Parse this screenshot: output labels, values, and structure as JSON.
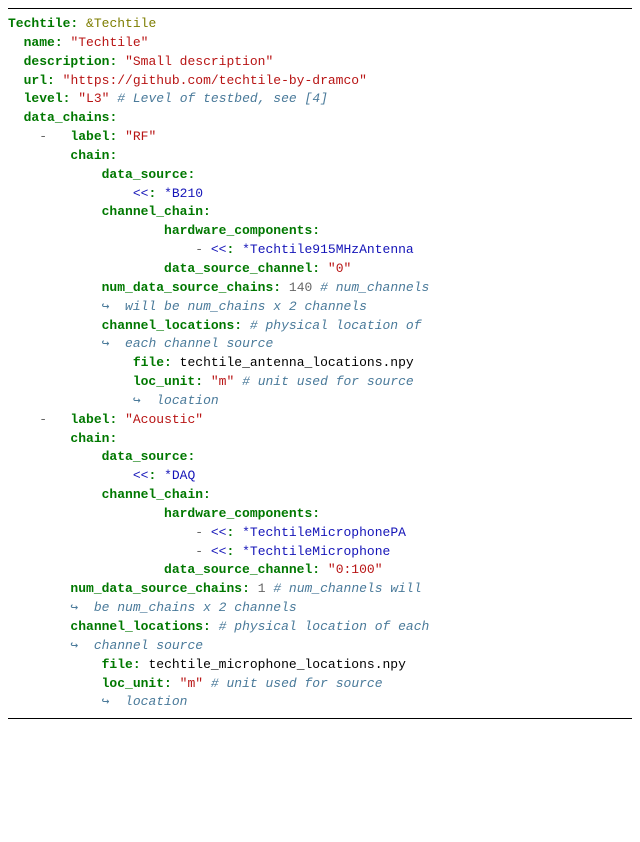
{
  "root": {
    "key": "Techtile",
    "anchor": "&Techtile"
  },
  "name": {
    "key": "name",
    "val": "\"Techtile\""
  },
  "description": {
    "key": "description",
    "val": "\"Small description\""
  },
  "url": {
    "key": "url",
    "val": "\"https://github.com/techtile-by-dramco\""
  },
  "level": {
    "key": "level",
    "val": "\"L3\"",
    "comment": "# Level of testbed, see [4]"
  },
  "data_chains_key": "data_chains",
  "item1": {
    "label": {
      "key": "label",
      "val": "\"RF\""
    },
    "chain_key": "chain",
    "data_source_key": "data_source",
    "merge": "<<",
    "b210": "*B210",
    "channel_chain_key": "channel_chain",
    "hardware_components_key": "hardware_components",
    "antenna": "*Techtile915MHzAntenna",
    "data_source_channel": {
      "key": "data_source_channel",
      "val": "\"0\""
    },
    "num_chains": {
      "key": "num_data_source_chains",
      "val": "140",
      "comment": "# num_channels"
    },
    "num_chains_cont": {
      "arrow": "↪",
      "text": "  will be num_chains x 2 channels"
    },
    "channel_locations": {
      "key": "channel_locations",
      "comment": "# physical location of"
    },
    "channel_locations_cont": {
      "arrow": "↪",
      "text": "  each channel source"
    },
    "file": {
      "key": "file",
      "val": "techtile_antenna_locations.npy"
    },
    "loc_unit": {
      "key": "loc_unit",
      "val": "\"m\"",
      "comment": "# unit used for source"
    },
    "loc_unit_cont": {
      "arrow": "↪",
      "text": "  location"
    }
  },
  "item2": {
    "label": {
      "key": "label",
      "val": "\"Acoustic\""
    },
    "chain_key": "chain",
    "data_source_key": "data_source",
    "merge": "<<",
    "daq": "*DAQ",
    "channel_chain_key": "channel_chain",
    "hardware_components_key": "hardware_components",
    "mic_pa": "*TechtileMicrophonePA",
    "mic": "*TechtileMicrophone",
    "data_source_channel": {
      "key": "data_source_channel",
      "val": "\"0:100\""
    },
    "num_chains": {
      "key": "num_data_source_chains",
      "val": "1",
      "comment": "# num_channels will"
    },
    "num_chains_cont": {
      "arrow": "↪",
      "text": "  be num_chains x 2 channels"
    },
    "channel_locations": {
      "key": "channel_locations",
      "comment": "# physical location of each"
    },
    "channel_locations_cont": {
      "arrow": "↪",
      "text": "  channel source"
    },
    "file": {
      "key": "file",
      "val": "techtile_microphone_locations.npy"
    },
    "loc_unit": {
      "key": "loc_unit",
      "val": "\"m\"",
      "comment": "# unit used for source"
    },
    "loc_unit_cont": {
      "arrow": "↪",
      "text": "  location"
    }
  }
}
